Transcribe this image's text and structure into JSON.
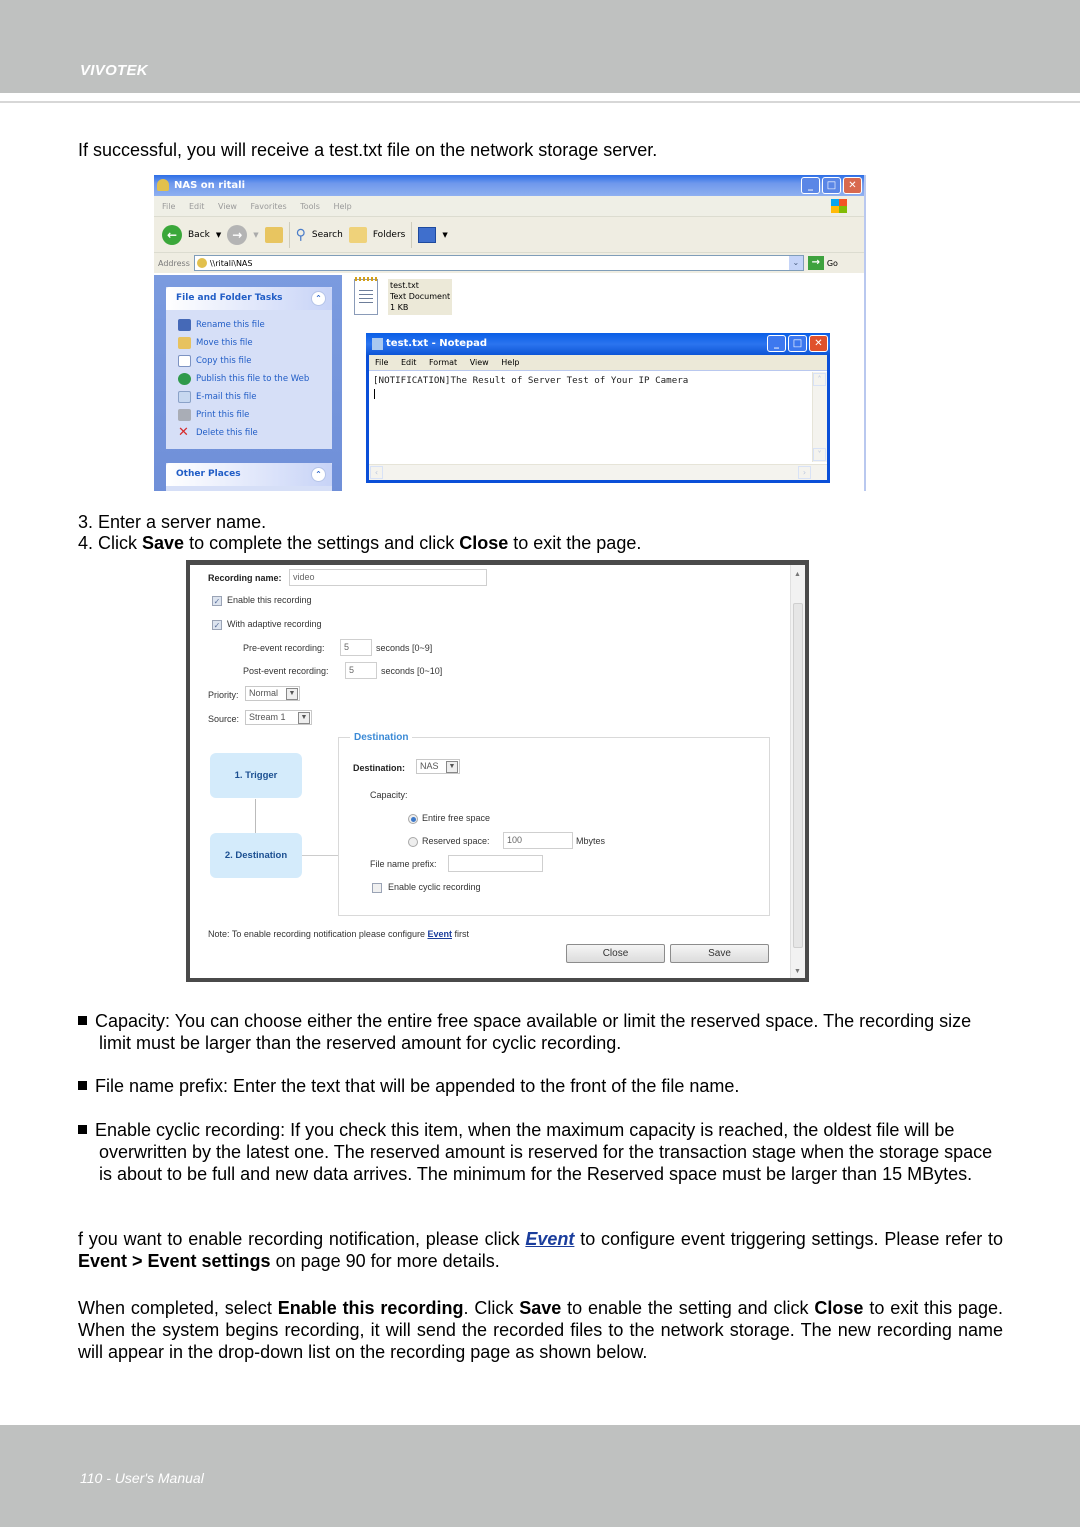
{
  "header": {
    "brand": "VIVOTEK"
  },
  "intro": "If successful, you will receive a test.txt file on the network storage server.",
  "explorer": {
    "title": "NAS on ritali",
    "menu": [
      "File",
      "Edit",
      "View",
      "Favorites",
      "Tools",
      "Help"
    ],
    "toolbar": {
      "back": "Back",
      "search": "Search",
      "folders": "Folders"
    },
    "address_label": "Address",
    "address_value": "\\\\ritali\\NAS",
    "go_label": "Go",
    "tasks_panel": {
      "title": "File and Folder Tasks",
      "items": [
        {
          "label": "Rename this file",
          "icon": "rename-icon"
        },
        {
          "label": "Move this file",
          "icon": "move-icon"
        },
        {
          "label": "Copy this file",
          "icon": "copy-icon"
        },
        {
          "label": "Publish this file to the Web",
          "icon": "globe-icon"
        },
        {
          "label": "E-mail this file",
          "icon": "email-icon"
        },
        {
          "label": "Print this file",
          "icon": "printer-icon"
        },
        {
          "label": "Delete this file",
          "icon": "delete-icon"
        }
      ]
    },
    "other_places_title": "Other Places",
    "file": {
      "name": "test.txt",
      "type": "Text Document",
      "size": "1 KB"
    }
  },
  "notepad": {
    "title": "test.txt - Notepad",
    "menu": [
      "File",
      "Edit",
      "Format",
      "View",
      "Help"
    ],
    "content": "[NOTIFICATION]The Result of Server Test of Your IP Camera"
  },
  "steps": {
    "step3": "3. Enter a server name.",
    "step4_prefix": "4. Click ",
    "step4_save": "Save",
    "step4_mid": " to complete the settings and click ",
    "step4_close": "Close",
    "step4_suffix": " to exit the page."
  },
  "recording_form": {
    "name_label": "Recording name:",
    "name_value": "video",
    "enable_label": "Enable this recording",
    "enable_checked": true,
    "adaptive_label": "With adaptive recording",
    "adaptive_checked": true,
    "pre_event_label": "Pre-event recording:",
    "pre_event_value": "5",
    "pre_event_unit": "seconds [0~9]",
    "post_event_label": "Post-event recording:",
    "post_event_value": "5",
    "post_event_unit": "seconds [0~10]",
    "priority_label": "Priority:",
    "priority_value": "Normal",
    "source_label": "Source:",
    "source_value": "Stream 1",
    "flow_steps": [
      "1. Trigger",
      "2. Destination"
    ],
    "destination_legend": "Destination",
    "destination_label": "Destination:",
    "destination_value": "NAS",
    "capacity_label": "Capacity:",
    "entire_free_label": "Entire free space",
    "entire_free_selected": true,
    "reserved_label": "Reserved space:",
    "reserved_value": "100",
    "reserved_unit": "Mbytes",
    "prefix_label": "File name prefix:",
    "prefix_value": "",
    "cyclic_label": "Enable cyclic recording",
    "cyclic_checked": false,
    "note_prefix": "Note: To enable recording notification please configure ",
    "note_link": "Event",
    "note_suffix": " first",
    "close_button": "Close",
    "save_button": "Save"
  },
  "bullets": [
    "Capacity: You can choose either the entire free space available or limit the reserved space. The recording size limit must be larger than the reserved amount for cyclic recording.",
    "File name prefix: Enter the text that will be appended to the front of the file name.",
    "Enable cyclic recording: If you check this item, when the maximum capacity is reached, the oldest file will be overwritten by the latest one. The reserved amount is reserved for the transaction stage when the storage space is about to be full and new data arrives. The minimum for the Reserved space must be larger than 15 MBytes."
  ],
  "notification_para": {
    "prefix": "f you want to enable recording notification, please click ",
    "link": "Event",
    "mid": " to configure event triggering settings. Please refer to ",
    "bold": "Event > Event settings",
    "suffix": " on page 90 for more details."
  },
  "completed_para": {
    "p1": "When completed, select ",
    "b1": "Enable this recording",
    "p2": ". Click ",
    "b2": "Save",
    "p3": " to enable the setting and click ",
    "b3": "Close",
    "p4": " to exit this page. When the system begins recording, it will send the recorded files to the network storage. The new recording name will appear in the drop-down list on the recording page as shown below."
  },
  "footer": {
    "text": "110 - User's Manual"
  }
}
